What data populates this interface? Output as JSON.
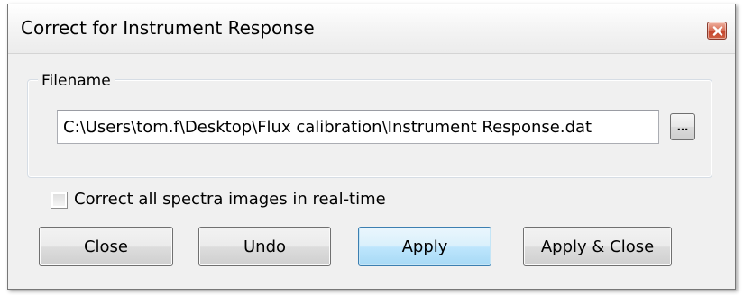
{
  "window": {
    "title": "Correct for Instrument Response"
  },
  "filename_group": {
    "label": "Filename",
    "path_value": "C:\\Users\\tom.f\\Desktop\\Flux calibration\\Instrument Response.dat",
    "browse_label": "..."
  },
  "options": {
    "realtime_checkbox_label": "Correct all spectra images in real-time",
    "realtime_checked": false
  },
  "buttons": {
    "close_label": "Close",
    "undo_label": "Undo",
    "apply_label": "Apply",
    "apply_close_label": "Apply & Close"
  },
  "colors": {
    "close_button_red": "#c3432b",
    "default_button_blue": "#3c7fb1",
    "dialog_background": "#f0f0f0"
  },
  "icons": {
    "window_close": "close-icon"
  }
}
